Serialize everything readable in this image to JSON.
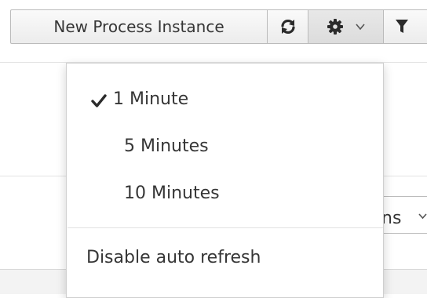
{
  "toolbar": {
    "new_instance_label": "New Process Instance",
    "refresh_icon": "refresh-icon",
    "settings_icon": "gear-icon",
    "settings_caret": "chevron-down-icon",
    "filter_icon": "filter-icon"
  },
  "refresh_menu": {
    "items": [
      {
        "label": "1 Minute",
        "selected": true
      },
      {
        "label": "5 Minutes",
        "selected": false
      },
      {
        "label": "10 Minutes",
        "selected": false
      }
    ],
    "disable_label": "Disable auto refresh",
    "check_icon": "checkmark-icon"
  },
  "background": {
    "partial_select_text": "ns"
  },
  "colors": {
    "text": "#363636",
    "border": "#bbbbbb",
    "menu_border": "#cfcfcf"
  }
}
